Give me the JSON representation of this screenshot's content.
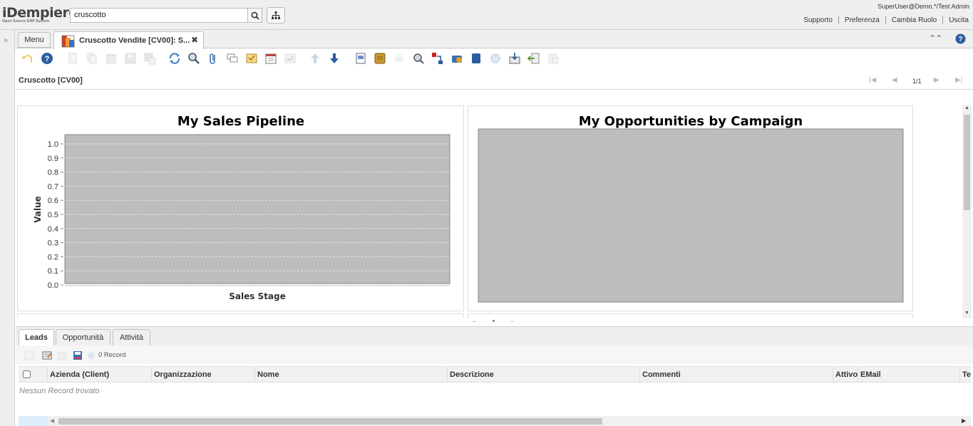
{
  "app": {
    "brand": "iDempiere",
    "tagline": "Open Source ERP System",
    "search_value": "cruscotto",
    "user": "SuperUser@Demo.*/Test Admin",
    "links": [
      "Supporto",
      "Preferenza",
      "Cambia Ruolo",
      "Uscita"
    ]
  },
  "tabs": {
    "menu": "Menu",
    "doc": "Cruscotto Vendite [CV00]: S..."
  },
  "toolbar": {
    "icons": [
      "undo-icon",
      "help-icon",
      "new-record-icon",
      "copy-record-icon",
      "delete-icon",
      "save-icon",
      "save-new-icon",
      "refresh-icon",
      "find-icon",
      "attachment-icon",
      "chat-icon",
      "grid-toggle-icon",
      "calendar-icon",
      "form-toggle-icon",
      "previous-record-icon",
      "next-record-icon",
      "report-icon",
      "archive-icon",
      "print-icon",
      "zoom-across-icon",
      "active-workflows-icon",
      "requests-icon",
      "product-info-icon",
      "customize-icon",
      "process-icon",
      "export-icon",
      "import-icon",
      "post-icon"
    ]
  },
  "breadcrumb": {
    "title": "Cruscotto [CV00]",
    "record_count": "1/1"
  },
  "panels": {
    "left": {
      "chart_title": "My Sales Pipeline",
      "ylabel": "Value",
      "xlabel": "Sales Stage"
    },
    "right": {
      "chart_title": "My Opportunities by Campaign"
    }
  },
  "chart_data": [
    {
      "type": "bar",
      "title": "My Sales Pipeline",
      "xlabel": "Sales Stage",
      "ylabel": "Value",
      "ylim": [
        0,
        1
      ],
      "y_ticks": [
        "0.0",
        "0.1",
        "0.2",
        "0.3",
        "0.4",
        "0.5",
        "0.6",
        "0.7",
        "0.8",
        "0.9",
        "1.0"
      ],
      "categories": [],
      "values": [],
      "grid": true
    },
    {
      "type": "bar",
      "title": "My Opportunities by Campaign",
      "categories": [],
      "values": []
    }
  ],
  "south": {
    "tabs": [
      "Leads",
      "Opportunità",
      "Attività"
    ],
    "record_label": "0 Record",
    "columns": [
      "Azienda (Client)",
      "Organizzazione",
      "Nome",
      "Descrizione",
      "Commenti",
      "Attivo",
      "EMail",
      "Te"
    ],
    "empty_text": "Nessun Record trovato"
  }
}
